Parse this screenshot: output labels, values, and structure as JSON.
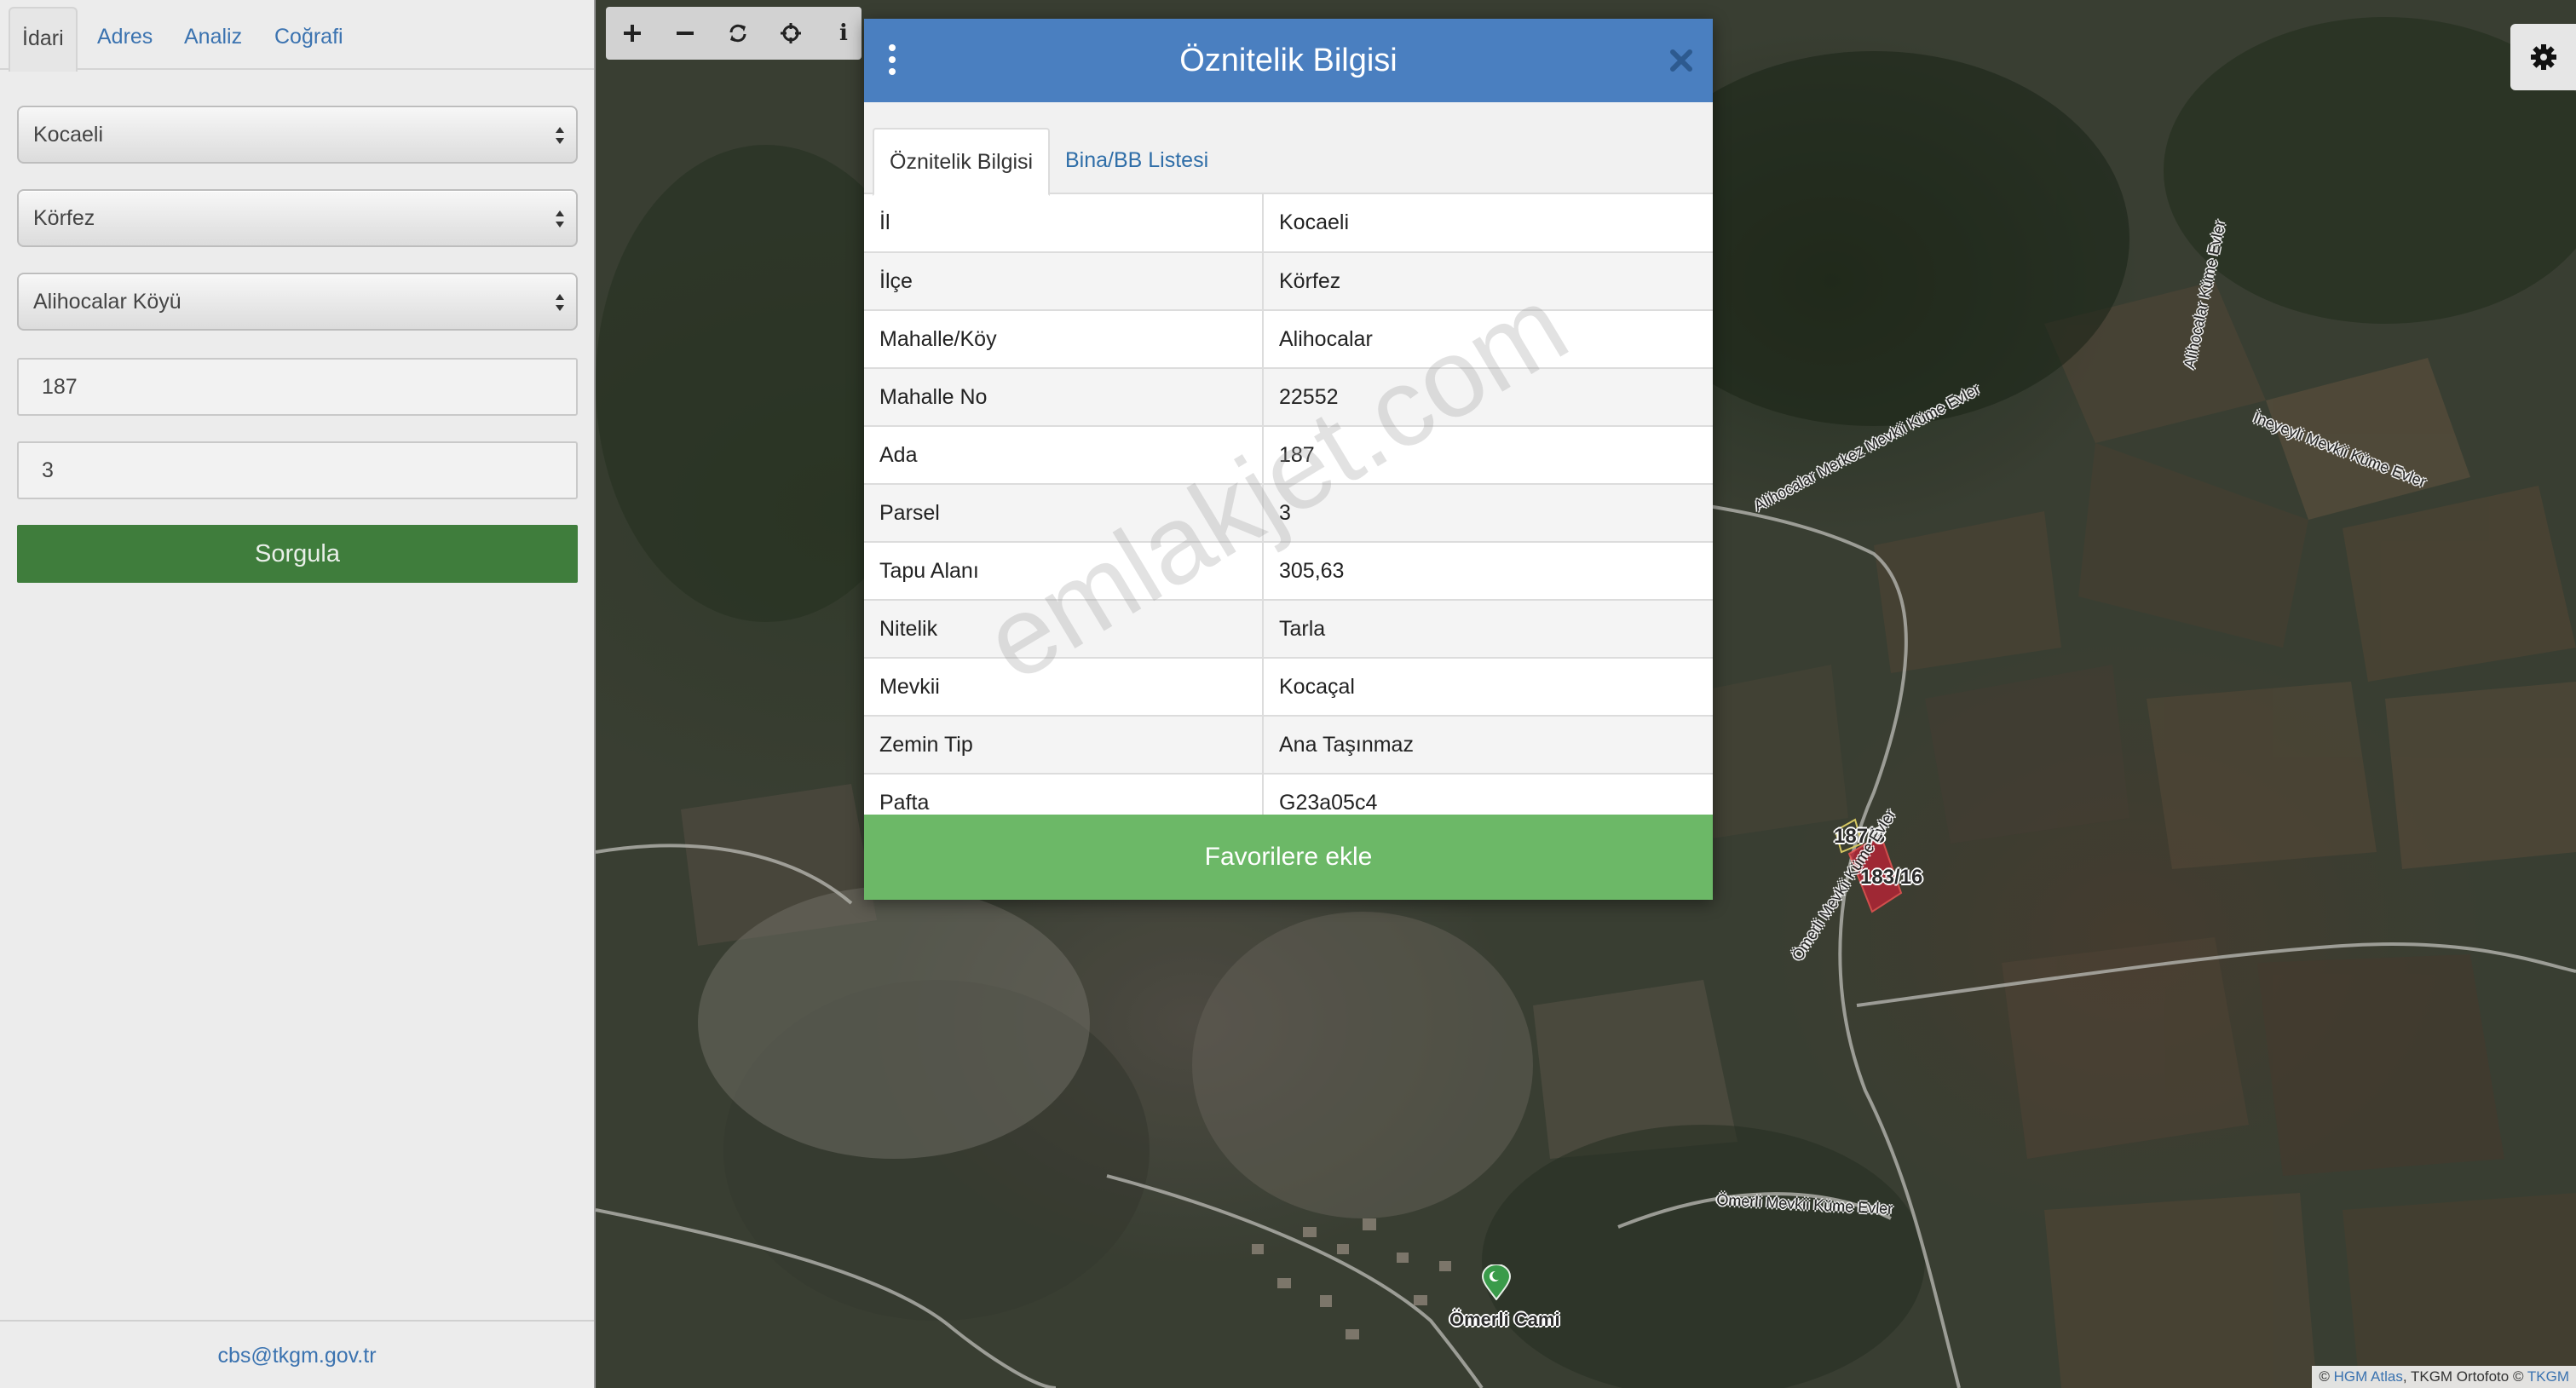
{
  "sidebar": {
    "tabs": [
      {
        "label": "İdari",
        "active": true
      },
      {
        "label": "Adres",
        "active": false
      },
      {
        "label": "Analiz",
        "active": false
      },
      {
        "label": "Coğrafi",
        "active": false
      }
    ],
    "selects": {
      "province": "Kocaeli",
      "district": "Körfez",
      "neighborhood": "Alihocalar Köyü"
    },
    "inputs": {
      "ada": "187",
      "parsel": "3"
    },
    "query_button": "Sorgula",
    "footer_email": "cbs@tkgm.gov.tr"
  },
  "map": {
    "toolbar_icons": [
      "zoom-in-icon",
      "zoom-out-icon",
      "refresh-icon",
      "locate-icon",
      "info-icon"
    ],
    "info_glyph": "i",
    "parcel_labels": {
      "primary": "187/3",
      "secondary": "183/16"
    },
    "road_labels": {
      "road1": "Alihocalar Merkez Mevkii Küme Evler",
      "road2": "Ömerli Mevkii Küme Evler",
      "road3": "Ömerli Mevkii Küme Evler",
      "road4": "İneyeyli Mevkii Küme Evler",
      "road5": "Alihocalar Küme Evler"
    },
    "poi": {
      "name": "Ömerli Cami",
      "icon": "mosque-marker-icon"
    },
    "attribution": {
      "prefix": "©",
      "link1": "HGM Atlas",
      "middle": ", TKGM Ortofoto ©",
      "link2": "TKGM"
    },
    "watermark": "emlakjet.com"
  },
  "modal": {
    "title": "Öznitelik Bilgisi",
    "tabs": [
      {
        "label": "Öznitelik Bilgisi",
        "active": true
      },
      {
        "label": "Bina/BB Listesi",
        "active": false
      }
    ],
    "rows": [
      {
        "key": "İl",
        "value": "Kocaeli"
      },
      {
        "key": "İlçe",
        "value": "Körfez"
      },
      {
        "key": "Mahalle/Köy",
        "value": "Alihocalar"
      },
      {
        "key": "Mahalle No",
        "value": "22552"
      },
      {
        "key": "Ada",
        "value": "187"
      },
      {
        "key": "Parsel",
        "value": "3"
      },
      {
        "key": "Tapu Alanı",
        "value": "305,63"
      },
      {
        "key": "Nitelik",
        "value": "Tarla"
      },
      {
        "key": "Mevkii",
        "value": "Kocaçal"
      },
      {
        "key": "Zemin Tip",
        "value": "Ana Taşınmaz"
      },
      {
        "key": "Pafta",
        "value": "G23a05c4"
      }
    ],
    "favorite_button": "Favorilere ekle"
  },
  "colors": {
    "header_blue": "#4a7fc0",
    "favorite_green": "#6cb867",
    "query_green": "#3f7d3c",
    "link_blue": "#3b73b0",
    "parcel_red": "#c0283a"
  }
}
